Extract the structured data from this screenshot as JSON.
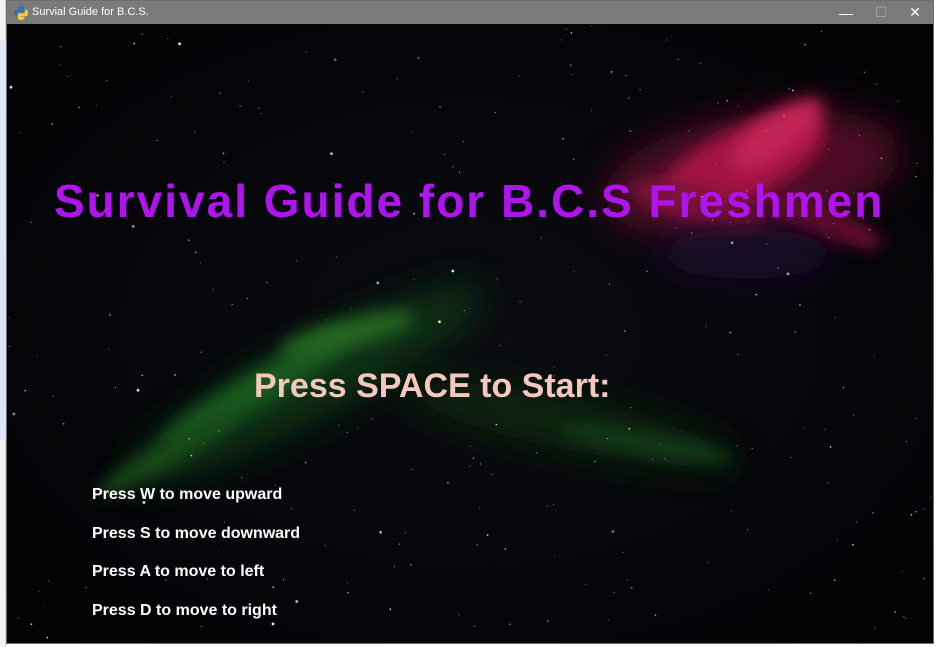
{
  "window": {
    "title": "Survial Guide for B.C.S.",
    "minimize_glyph": "—",
    "maximize_glyph": "☐",
    "close_glyph": "✕",
    "icon": "python-icon"
  },
  "game": {
    "title": "Survival Guide for B.C.S Freshmen",
    "title_color": "#b014ee",
    "prompt": "Press SPACE to Start:",
    "prompt_color": "#f6c8bd",
    "controls": [
      "Press W to move upward",
      "Press S to move downward",
      "Press A to move to left",
      "Press D to move to right"
    ],
    "controls_color": "#ffffff",
    "background": "starfield with nebula"
  }
}
